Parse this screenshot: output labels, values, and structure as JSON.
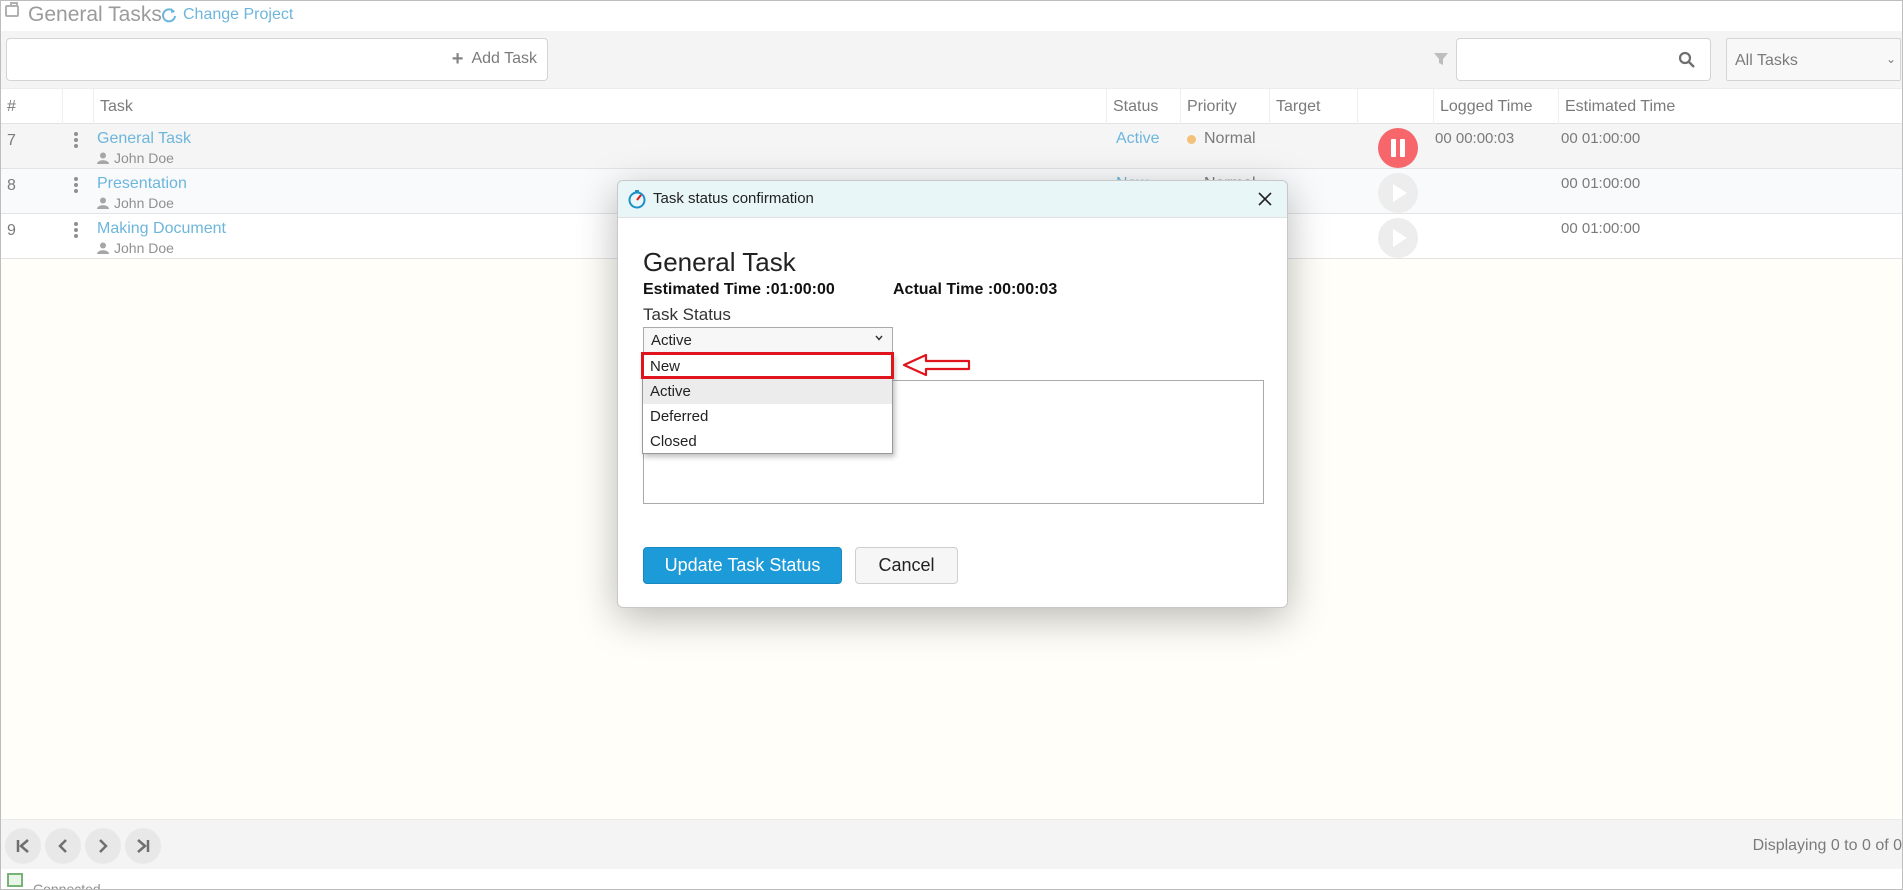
{
  "header": {
    "title": "General Tasks",
    "change_project": "Change Project"
  },
  "toolbar": {
    "add_task": "Add Task",
    "search_value": "",
    "filter_select": "All Tasks"
  },
  "columns": [
    "#",
    "",
    "Task",
    "Status",
    "Priority",
    "Target Date",
    "",
    "Logged Time",
    "Estimated Time"
  ],
  "rows": [
    {
      "num": "7",
      "task": "General Task",
      "assignee": "John Doe",
      "status": "Active",
      "priority": "Normal",
      "target_date": "",
      "logged": "00 00:00:03",
      "estimated": "00 01:00:00",
      "timer": "pause-icon"
    },
    {
      "num": "8",
      "task": "Presentation",
      "assignee": "John Doe",
      "status": "New",
      "priority": "Normal",
      "target_date": "",
      "logged": "",
      "estimated": "00 01:00:00",
      "timer": "play-icon"
    },
    {
      "num": "9",
      "task": "Making Document",
      "assignee": "John Doe",
      "status": "",
      "priority": "",
      "target_date": "",
      "logged": "",
      "estimated": "00 01:00:00",
      "timer": "play-icon"
    }
  ],
  "footer": {
    "display_text": "Displaying 0 to 0 of 0"
  },
  "statusbar": {
    "connection": "Connected"
  },
  "dialog": {
    "title": "Task status confirmation",
    "task_name": "General Task",
    "estimated": "Estimated Time :01:00:00",
    "actual": "Actual Time :00:00:03",
    "status_label": "Task Status",
    "selected_status": "Active",
    "options": [
      "New",
      "Active",
      "Deferred",
      "Closed"
    ],
    "update_button": "Update Task Status",
    "cancel_button": "Cancel"
  },
  "colors": {
    "accent": "#1e90c9",
    "stop": "#f2141c",
    "priority": "#f0a030",
    "highlight": "#e0141c",
    "primary_button": "#1d9ad8"
  }
}
